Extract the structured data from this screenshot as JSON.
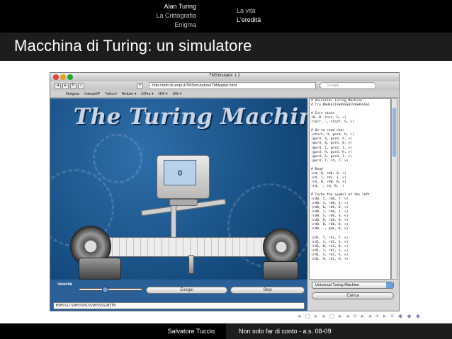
{
  "header": {
    "section_1": "Alan Turing",
    "section_2": "La Crittografia",
    "section_3": "Enigma",
    "sub_1": "La vita",
    "sub_2": "L'eredità"
  },
  "slide_title": "Macchina di Turing: un simulatore",
  "browser": {
    "title": "TMSimulator 1.2",
    "url": "http://mdt.di.unipi.it/TMSimulatore/TMApplet.html",
    "search_placeholder": "Google",
    "bookmarks": [
      "Netgear",
      "IntesaSP",
      "Yahoo!",
      "Notizie ▾",
      "SiTes ▾",
      "HW ▾",
      "SW ▾"
    ]
  },
  "applet": {
    "banner": "The Turing Machine",
    "screen_value": "0",
    "velocity_label": "Velocità",
    "run_button": "Esegui",
    "stop_button": "Stop",
    "input_tape": "BSHSS11SSHSSS01SSSHSSSS1NTTN",
    "machine_select": "Universal Turing Machine",
    "load_button": "Carica",
    "program_lines": [
      "# Universal Turing Machine",
      "# Try BSHSS11SSHSSS01SSSHSSSS1",
      "",
      "# Init state",
      "(0, B, init, S, <)",
      "(init, -, start, S, >)",
      "",
      "# Go to read char",
      "(start, H, gord, H, >)",
      "(gord, S, gord, S, >)",
      "(gord, 0, gord, 0, >)",
      "(gord, 1, gord, 1, >)",
      "(gord, H, gord, H, >)",
      "(gord, 1, gord, 1, >)",
      "(gord, T, rd, T, >)",
      "",
      "# Read",
      "(rd, 0, rd0, 0, <)",
      "(rd, 1, rd1, 1, <)",
      "(rd, B, rdB, B, <)",
      "(rd, -, rd, B, -)",
      "",
      "# Cache the symbol at the left",
      "(rd0, T, rd0, T, <)",
      "(rd0, 1, rd0, 1, <)",
      "(rd0, 0, rd0, 0, <)",
      "(rd0, 1, rd0, 1, <)",
      "(rd0, S, rd0, S, <)",
      "(rd0, H, rd0, H, <)",
      "(rd0, B, rd0, B, <)",
      "(rd0, -, gom, 0, >)",
      "",
      "(rd1, T, rd1, T, <)",
      "(rd1, 1, rd1, 1, <)",
      "(rd1, 0, rd1, 0, <)",
      "(rd1, 1, rd1, 1, <)",
      "(rd1, S, rd1, S, <)",
      "(rd1, H, rd1, H, <)"
    ]
  },
  "nav_symbols": "◂ ▢ ▸ ◂ ▢ ▸ ◂ ≡ ▸ ◂ ≡ ▸ ≡ ◆ ◆ ◆",
  "footer": {
    "author": "Salvatore Tuccio",
    "talk": "Non solo far di conto - a.s. 08-09"
  },
  "colors": {
    "applet_blue": "#1b4f86",
    "header_black": "#000000",
    "title_bar": "#1d1d1d"
  }
}
